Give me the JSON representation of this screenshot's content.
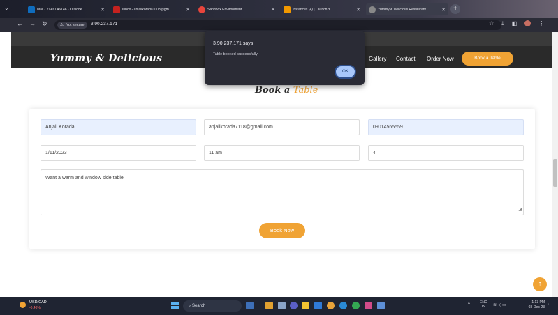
{
  "browser": {
    "tabs": [
      {
        "label": "Mail - 21A61A6146 - Outlook",
        "color": "#0f6cbd"
      },
      {
        "label": "Inbox - anjalikorada1008@gm...",
        "color": "#c5221f"
      },
      {
        "label": "Sandbox Environment",
        "color": "#e8453c"
      },
      {
        "label": "Instances (4) | Launch Y",
        "color": "#f29900"
      },
      {
        "label": "Yummy & Delicious Restaurant",
        "color": "#888888"
      }
    ],
    "not_secure": "Not secure",
    "url": "3.90.237.171"
  },
  "site": {
    "logo": "Yummy & Delicious",
    "nav": {
      "gallery": "Gallery",
      "contact": "Contact",
      "order": "Order Now",
      "book": "Book a Table"
    },
    "section_title_a": "Book a",
    "section_title_b": "Table",
    "accent_color": "#f0a334"
  },
  "form": {
    "name": "Anjali Korada",
    "email": "anjalikorada7118@gmail.com",
    "phone": "09014565559",
    "date": "1/11/2023",
    "time": "11 am",
    "people": "4",
    "message": "Want a warm and window side table",
    "submit": "Book Now"
  },
  "alert": {
    "title": "3.90.237.171 says",
    "message": "Table booked successfully",
    "ok": "OK"
  },
  "taskbar": {
    "ticker_name": "USD/CAD",
    "ticker_change": "-0.46%",
    "search": "Search",
    "lang_top": "ENG",
    "lang_bottom": "IN",
    "time": "1:13 PM",
    "date": "03-Dec-23"
  }
}
